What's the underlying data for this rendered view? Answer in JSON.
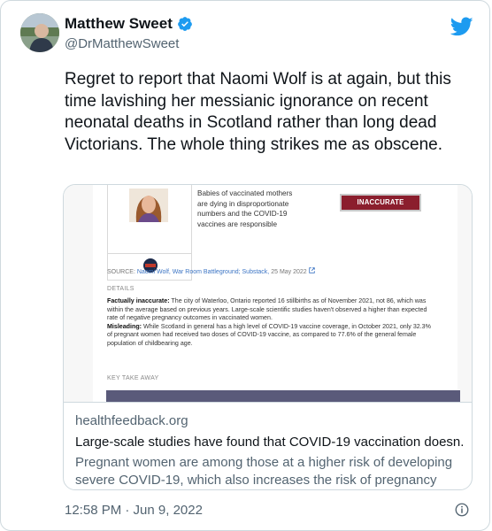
{
  "author": {
    "name": "Matthew Sweet",
    "handle": "@DrMatthewSweet"
  },
  "tweet": {
    "text": "Regret to report that Naomi Wolf is at again, but this time lavishing her messianic ignorance on recent neonatal deaths in Scotland rather than long dead Victorians. The whole thing strikes me as obscene."
  },
  "card": {
    "image": {
      "claim": "Babies of vaccinated mothers are dying in disproportionate numbers and the COVID-19 vaccines are responsible",
      "verdict": "INACCURATE",
      "source_label": "SOURCE:",
      "source_text": "Naomi Wolf, War Room Battleground; Substack,",
      "source_date": "25 May 2022",
      "details_label": "DETAILS",
      "detail1_bold": "Factually inaccurate:",
      "detail1_text": "The city of Waterloo, Ontario reported 16 stillbirths as of November 2021, not 86, which was within the average based on previous years. Large-scale scientific studies haven't observed a higher than expected rate of negative pregnancy outcomes in vaccinated women.",
      "detail2_bold": "Misleading:",
      "detail2_text": "While Scotland in general has a high level of COVID-19 vaccine coverage, in October 2021, only 32.3% of pregnant women had received two doses of COVID-19 vaccine, as compared to 77.6% of the general female population of childbearing age.",
      "takeaway_label": "KEY TAKE AWAY"
    },
    "domain": "healthfeedback.org",
    "title": "Large-scale studies have found that COVID-19 vaccination doesn...",
    "description": "Pregnant women are among those at a higher risk of developing severe COVID-19, which also increases the risk of pregnancy"
  },
  "timestamp": "12:58 PM · Jun 9, 2022",
  "icons": {
    "verified": "verified-badge-icon",
    "twitter": "twitter-bird-icon",
    "info": "info-icon",
    "external": "external-link-icon"
  },
  "colors": {
    "twitter_blue": "#1d9bf0",
    "verdict_red": "#8b1e2d",
    "secondary_text": "#536471"
  }
}
